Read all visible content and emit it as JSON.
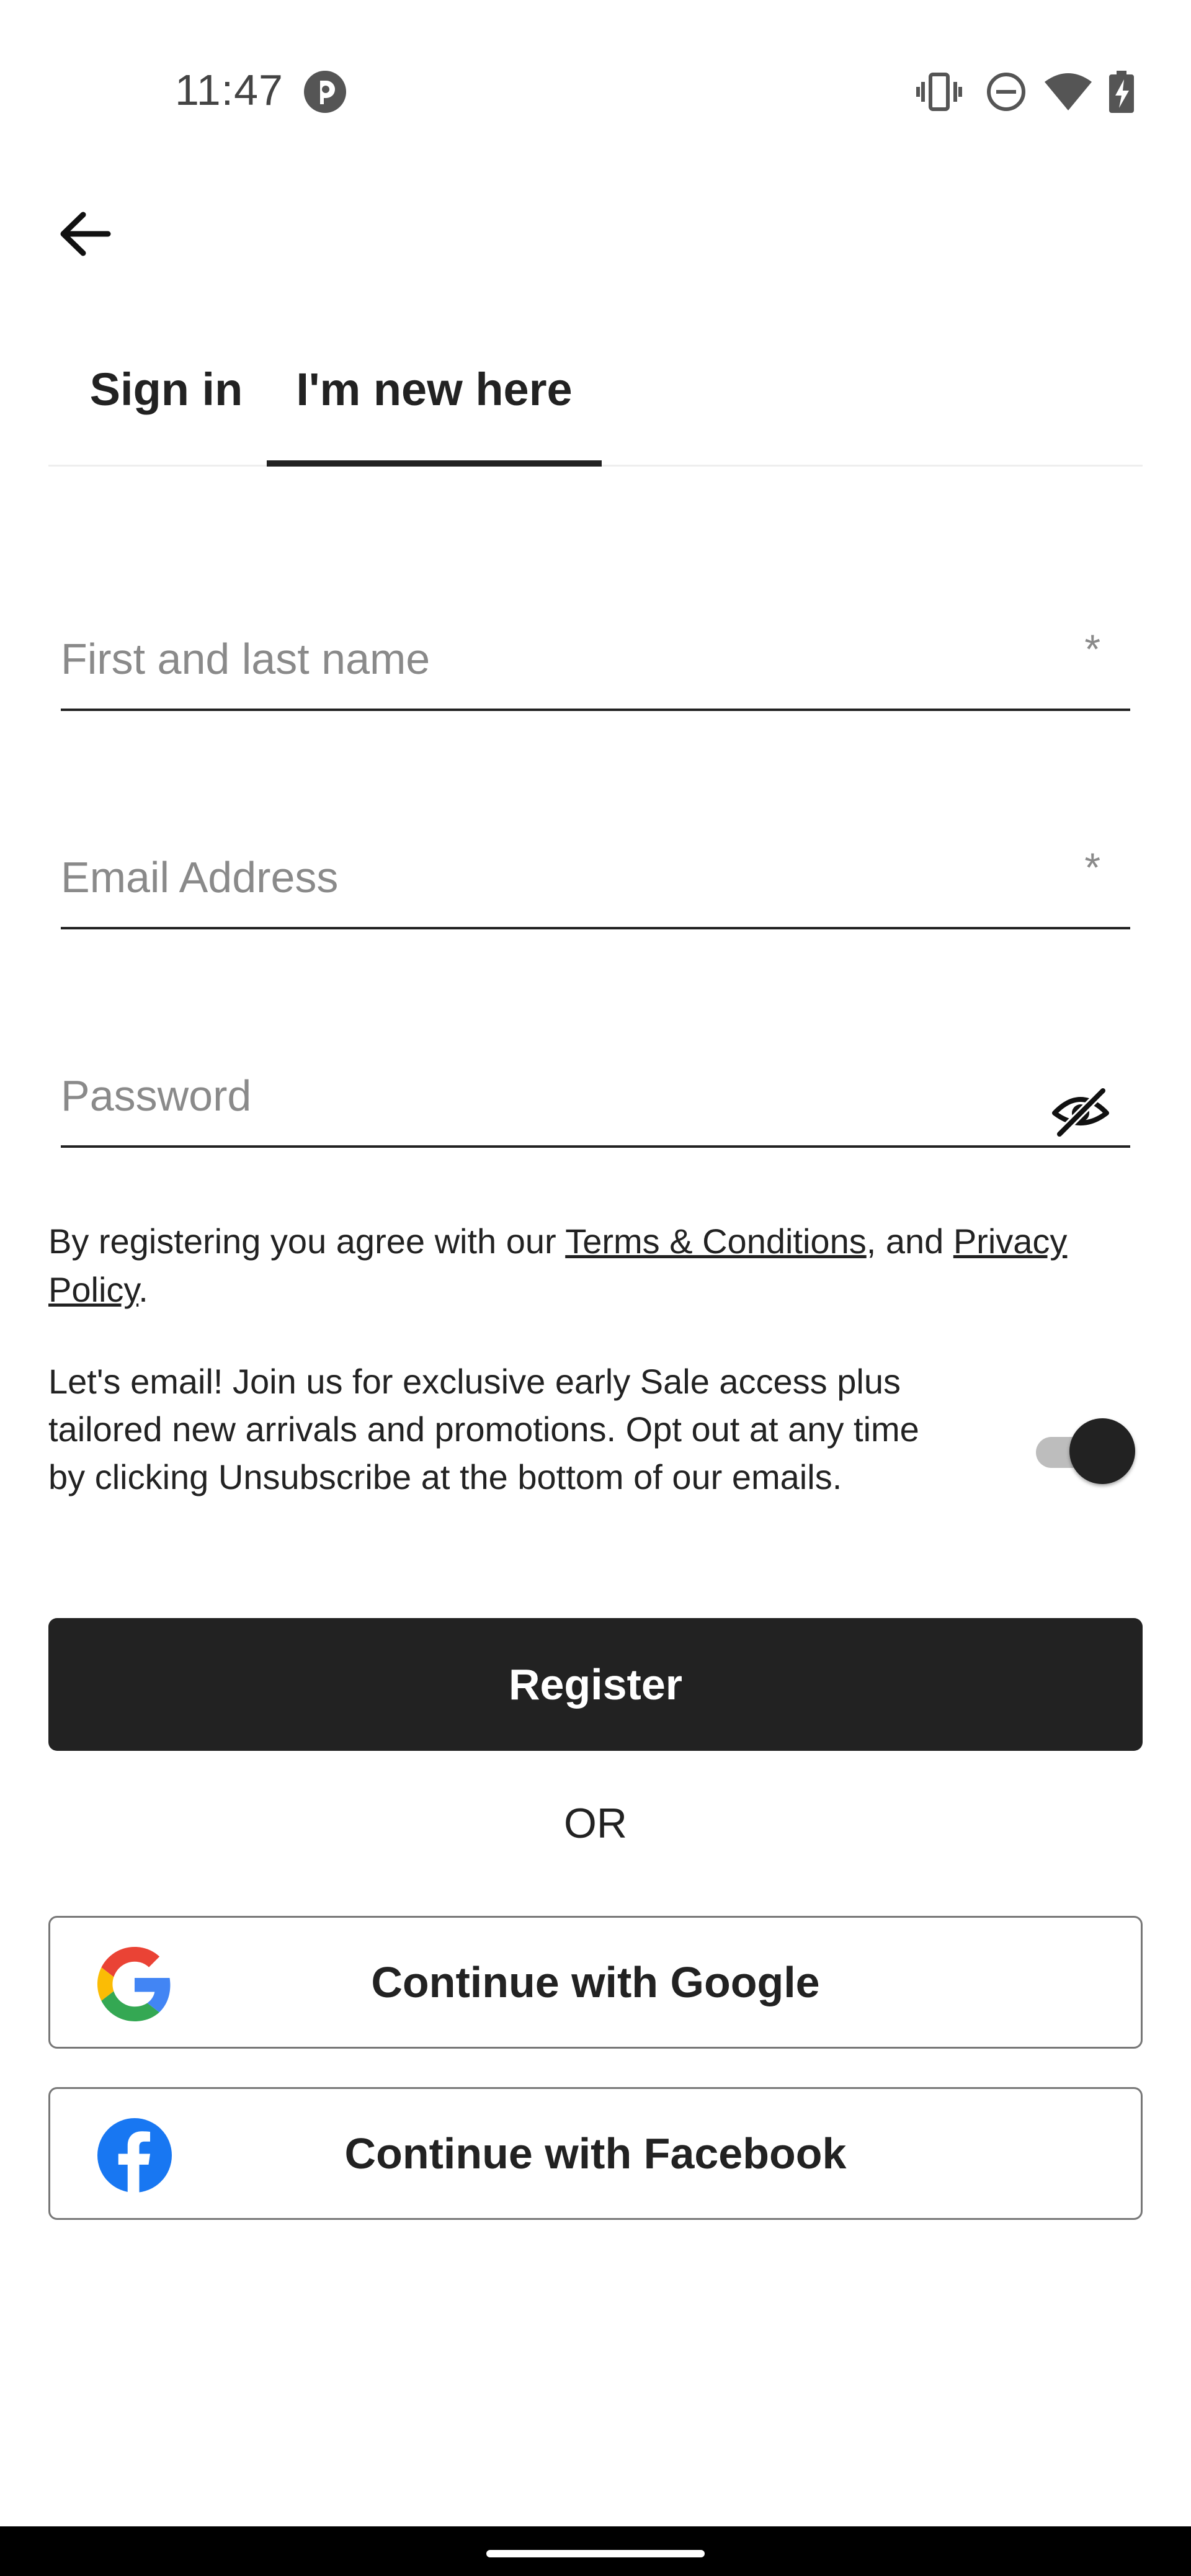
{
  "status_bar": {
    "time": "11:47",
    "icons": [
      "vibrate-icon",
      "do-not-disturb-icon",
      "wifi-icon",
      "battery-charging-icon"
    ]
  },
  "header": {
    "back_icon": "arrow-left-icon"
  },
  "tabs": [
    {
      "label": "Sign in",
      "selected": false
    },
    {
      "label": "I'm new here",
      "selected": true
    }
  ],
  "form": {
    "name_field": {
      "placeholder": "First and last name",
      "value": "",
      "required_mark": "*"
    },
    "email_field": {
      "placeholder": "Email Address",
      "value": "",
      "required_mark": "*"
    },
    "password_field": {
      "placeholder": "Password",
      "value": "",
      "toggle_icon": "eye-off-icon"
    }
  },
  "terms": {
    "prefix": "By registering you agree with our ",
    "terms_link": "Terms & Conditions",
    "middle": ", and ",
    "privacy_link": "Privacy Policy",
    "suffix": "."
  },
  "marketing_optin": {
    "text": "Let's email! Join us for exclusive early Sale access plus tailored new arrivals and promotions. Opt out at any time by clicking Unsubscribe at the bottom of our emails.",
    "enabled": true
  },
  "actions": {
    "register_label": "Register",
    "or_label": "OR",
    "google_label": "Continue with Google",
    "facebook_label": "Continue with Facebook"
  },
  "colors": {
    "primary": "#222222",
    "background": "#ffffff",
    "placeholder": "#8a8a8a",
    "facebook_blue": "#1877F2"
  }
}
